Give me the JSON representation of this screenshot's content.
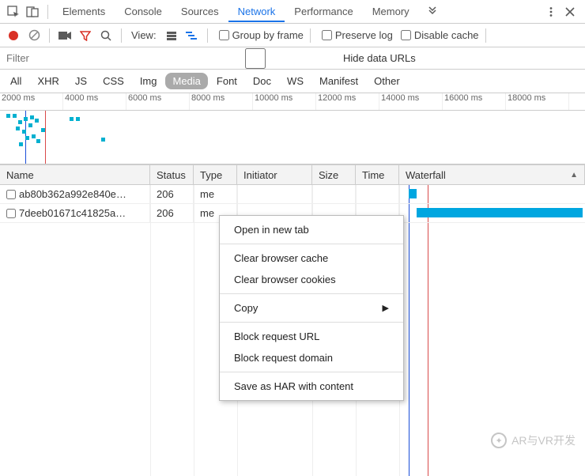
{
  "tabs": {
    "items": [
      "Elements",
      "Console",
      "Sources",
      "Network",
      "Performance",
      "Memory"
    ],
    "active_index": 3
  },
  "toolbar": {
    "view_label": "View:",
    "group_by_frame": "Group by frame",
    "preserve_log": "Preserve log",
    "disable_cache": "Disable cache"
  },
  "filter": {
    "placeholder": "Filter",
    "hide_data_urls": "Hide data URLs"
  },
  "type_filters": {
    "items": [
      "All",
      "XHR",
      "JS",
      "CSS",
      "Img",
      "Media",
      "Font",
      "Doc",
      "WS",
      "Manifest",
      "Other"
    ],
    "active_index": 5
  },
  "timeline": {
    "ticks": [
      "2000 ms",
      "4000 ms",
      "6000 ms",
      "8000 ms",
      "10000 ms",
      "12000 ms",
      "14000 ms",
      "16000 ms",
      "18000 ms"
    ]
  },
  "columns": {
    "name": "Name",
    "status": "Status",
    "type": "Type",
    "initiator": "Initiator",
    "size": "Size",
    "time": "Time",
    "waterfall": "Waterfall"
  },
  "rows": [
    {
      "name": "ab80b362a992e840e…",
      "status": "206",
      "type": "me"
    },
    {
      "name": "7deeb01671c41825a…",
      "status": "206",
      "type": "me"
    }
  ],
  "context_menu": {
    "items": [
      {
        "label": "Open in new tab"
      },
      {
        "sep": true
      },
      {
        "label": "Clear browser cache"
      },
      {
        "label": "Clear browser cookies"
      },
      {
        "sep": true
      },
      {
        "label": "Copy",
        "submenu": true
      },
      {
        "sep": true
      },
      {
        "label": "Block request URL"
      },
      {
        "label": "Block request domain"
      },
      {
        "sep": true
      },
      {
        "label": "Save as HAR with content"
      }
    ]
  },
  "watermark": "AR与VR开发"
}
